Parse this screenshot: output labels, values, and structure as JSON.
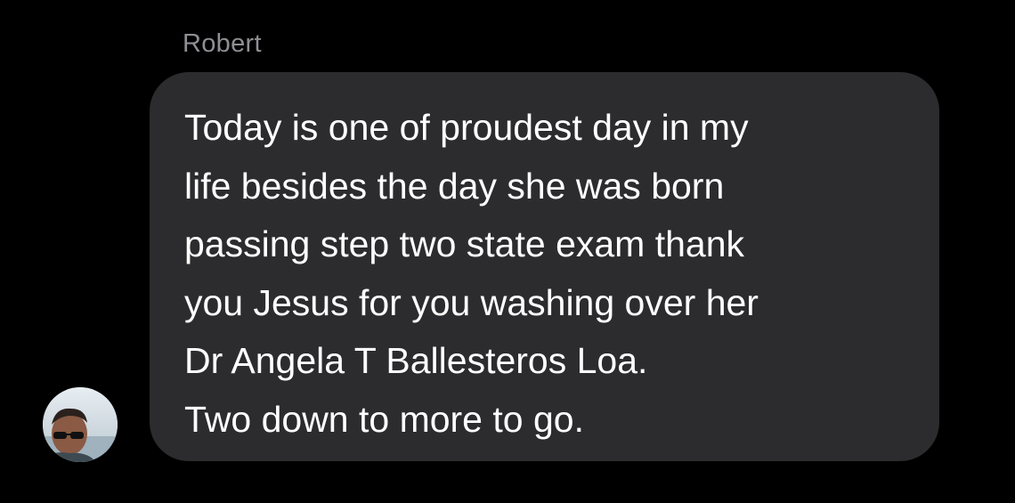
{
  "conversation": {
    "sender_name": "Robert",
    "avatar_icon": "user-photo-avatar",
    "message": {
      "lines": [
        "Today is one of proudest day in my",
        "life besides the day she was born",
        "passing step two state exam thank",
        "you Jesus for you washing over her",
        "Dr Angela T Ballesteros Loa.",
        "Two down to more to go."
      ]
    }
  },
  "colors": {
    "background": "#000000",
    "bubble": "#2c2c2e",
    "sender_name": "#8e8e93",
    "message_text": "#ffffff"
  }
}
